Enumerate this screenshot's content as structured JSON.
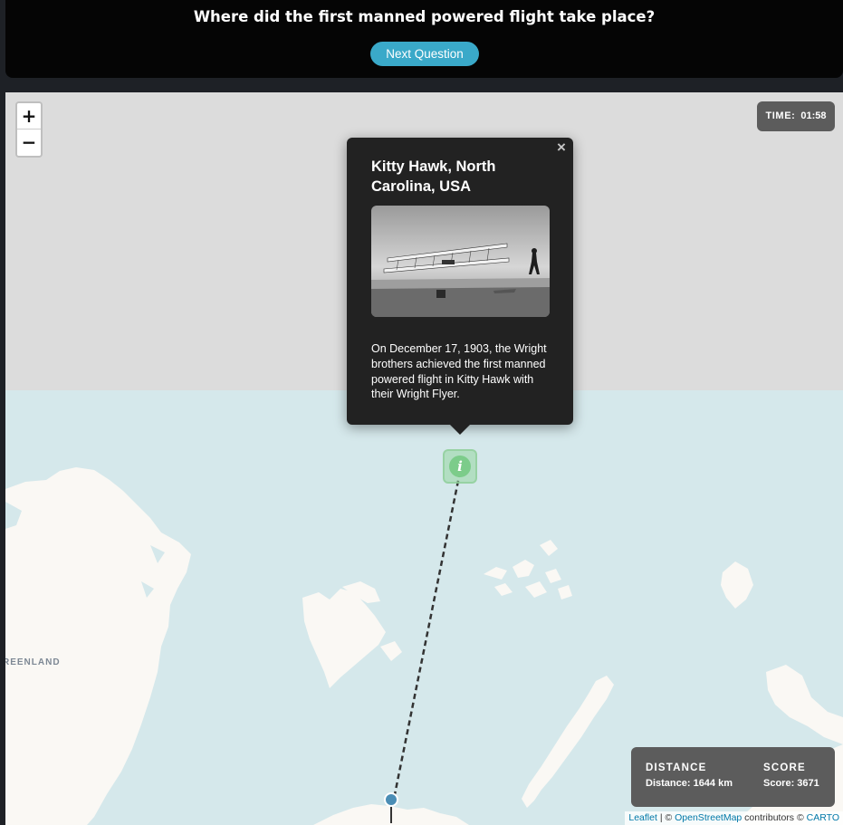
{
  "question": "Where did the first manned powered flight take place?",
  "next_button": "Next Question",
  "zoom": {
    "in_label": "+",
    "out_label": "−"
  },
  "timer": {
    "label": "TIME:",
    "value": "01:58"
  },
  "popup": {
    "close_glyph": "×",
    "title": "Kitty Hawk, North Carolina, USA",
    "photo_icon": "wright-flyer-photo",
    "description": "On December 17, 1903, the Wright brothers achieved the first manned powered flight in Kitty Hawk with their Wright Flyer."
  },
  "marker": {
    "icon": "info-icon",
    "glyph": "i",
    "color": "#7ccc8a"
  },
  "map": {
    "place_label": "REENLAND",
    "land_color": "#faf8f4",
    "water_color": "#d5e8eb",
    "unloaded_color": "#dcdcdc",
    "line_color": "#333333",
    "pin_color": "#4a8db5"
  },
  "stats": {
    "distance_header": "DISTANCE",
    "distance_value": "Distance: 1644 km",
    "score_header": "SCORE",
    "score_value": "Score: 3671"
  },
  "attribution": {
    "leaflet": "Leaflet",
    "separator": " | © ",
    "osm": "OpenStreetMap",
    "contributors": " contributors © ",
    "carto": "CARTO"
  }
}
